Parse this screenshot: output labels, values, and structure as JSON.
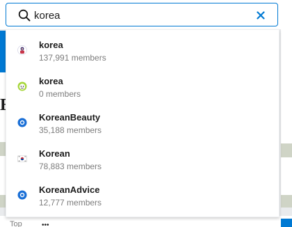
{
  "search": {
    "query": "korea",
    "icon": "search-icon",
    "clear_icon": "close-icon"
  },
  "results": [
    {
      "name": "korea",
      "members": "137,991 members",
      "icon": "korea-community-avatar-icon"
    },
    {
      "name": "korea",
      "members": "0 members",
      "icon": "green-face-avatar-icon"
    },
    {
      "name": "KoreanBeauty",
      "members": "35,188 members",
      "icon": "blue-community-icon"
    },
    {
      "name": "Korean",
      "members": "78,883 members",
      "icon": "korean-flag-avatar-icon"
    },
    {
      "name": "KoreanAdvice",
      "members": "12,777 members",
      "icon": "blue-community-icon"
    }
  ],
  "background": {
    "partial_heading": "E",
    "partial_bottom_text": "Top"
  },
  "colors": {
    "accent": "#0079d3",
    "text_primary": "#1c1c1c",
    "text_secondary": "#7c7c7c",
    "border": "#edeff1"
  }
}
